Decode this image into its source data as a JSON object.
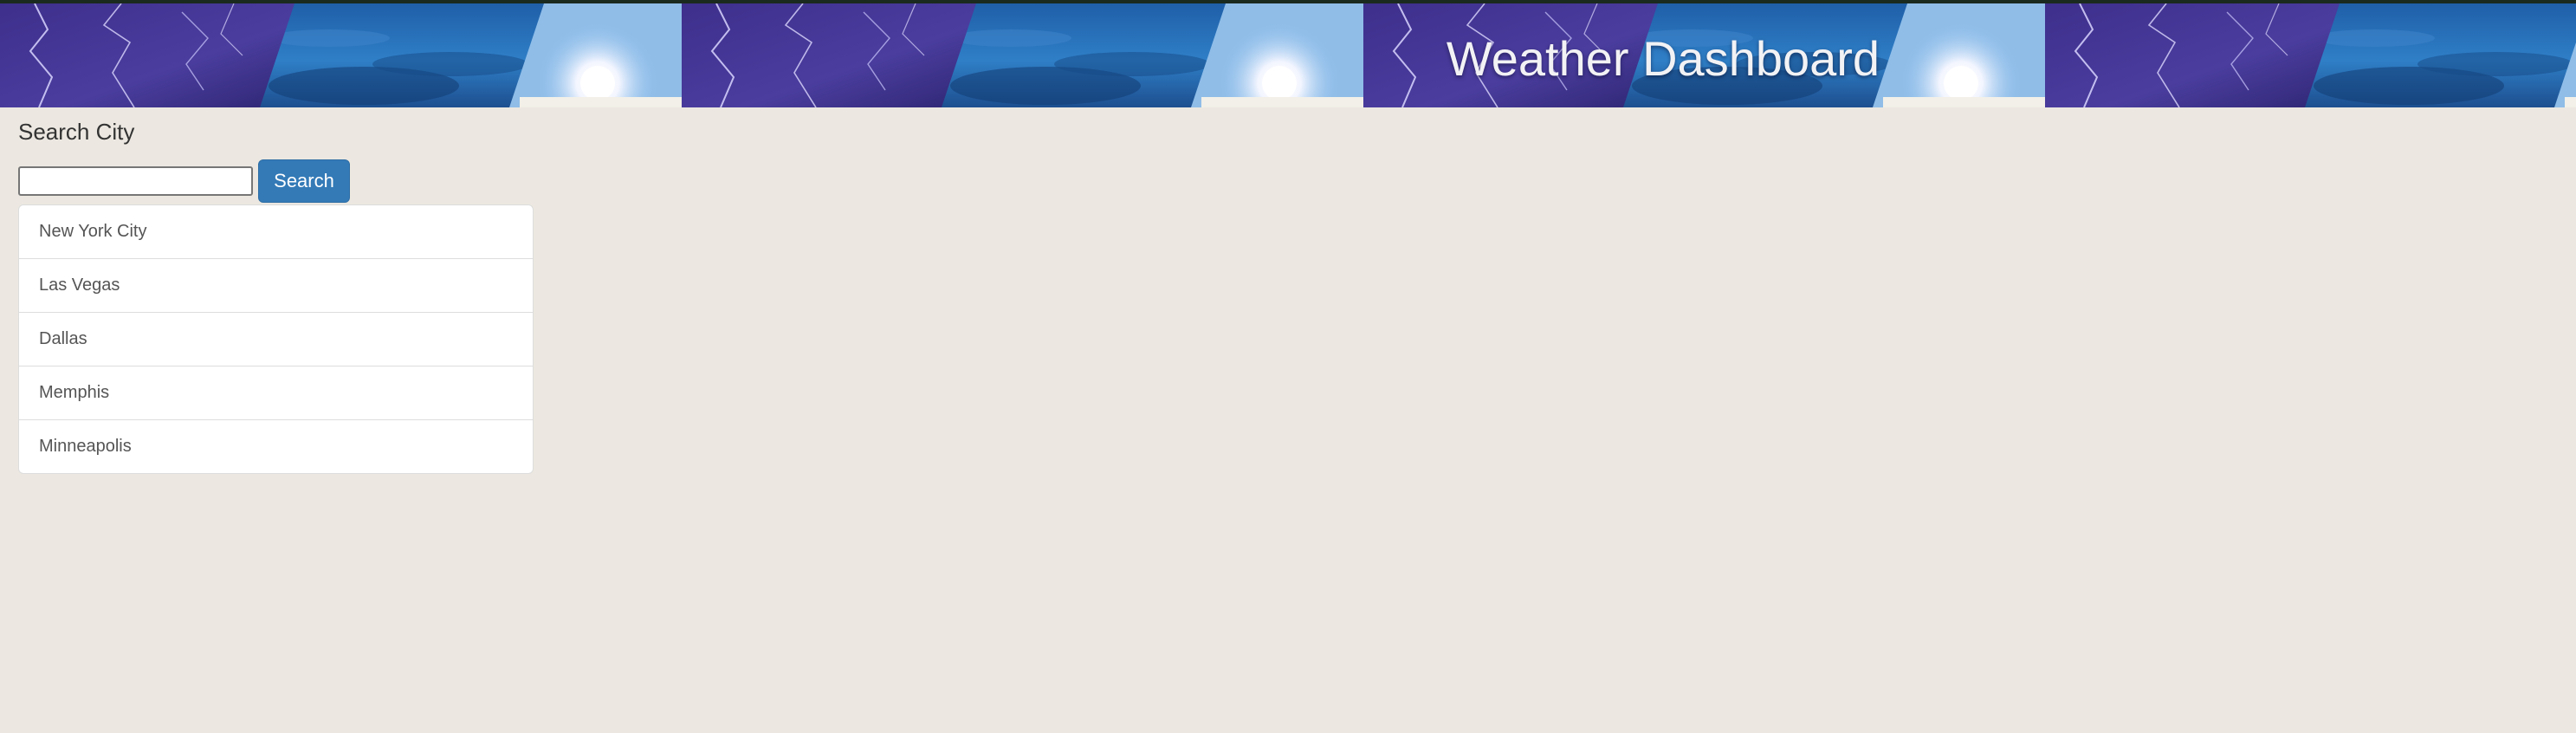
{
  "header": {
    "title": "Weather Dashboard",
    "banner_image": "storm-and-sun-banner"
  },
  "search": {
    "heading": "Search City",
    "input_value": "",
    "input_placeholder": "",
    "button_label": "Search"
  },
  "cities": [
    {
      "label": "New York City"
    },
    {
      "label": "Las Vegas"
    },
    {
      "label": "Dallas"
    },
    {
      "label": "Memphis"
    },
    {
      "label": "Minneapolis"
    }
  ],
  "colors": {
    "page_background": "#ece8e1",
    "button_primary": "#337ab7",
    "header_title": "#f2f2f5"
  }
}
